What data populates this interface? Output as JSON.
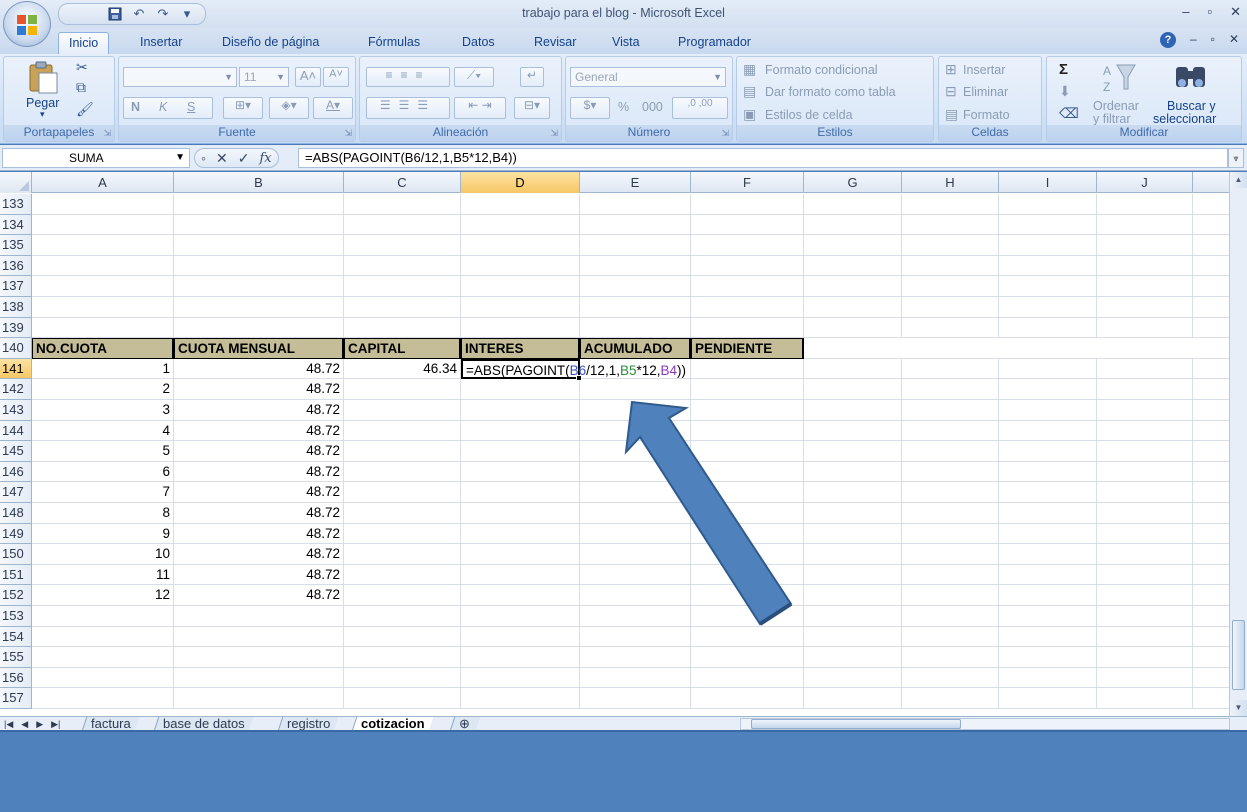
{
  "window": {
    "title": "trabajo para el blog - Microsoft Excel",
    "controls": [
      "–",
      "▫",
      "✕"
    ],
    "doc_controls": [
      "?",
      "–",
      "▫",
      "✕"
    ]
  },
  "ribbon_tabs": [
    "Inicio",
    "Insertar",
    "Diseño de página",
    "Fórmulas",
    "Datos",
    "Revisar",
    "Vista",
    "Programador"
  ],
  "ribbon": {
    "clipboard": {
      "paste": "Pegar",
      "label": "Portapapeles"
    },
    "font": {
      "size": "11",
      "bold": "N",
      "italic": "K",
      "underline": "S",
      "label": "Fuente"
    },
    "alignment": {
      "label": "Alineación"
    },
    "number": {
      "format": "General",
      "percent": "%",
      "thousands": "000",
      "label": "Número"
    },
    "styles": {
      "conditional": "Formato condicional",
      "as_table": "Dar formato como tabla",
      "cell_styles": "Estilos de celda",
      "label": "Estilos"
    },
    "cells": {
      "insert": "Insertar",
      "delete": "Eliminar",
      "format": "Formato",
      "label": "Celdas"
    },
    "editing": {
      "sum": "Σ",
      "sort_1": "Ordenar",
      "sort_2": "y filtrar",
      "find_1": "Buscar y",
      "find_2": "seleccionar",
      "label": "Modificar"
    }
  },
  "formula_bar": {
    "name_box": "SUMA",
    "cancel": "✕",
    "enter": "✓",
    "fx": "fx",
    "formula": "=ABS(PAGOINT(B6/12,1,B5*12,B4))"
  },
  "columns": [
    "A",
    "B",
    "C",
    "D",
    "E",
    "F",
    "G",
    "H",
    "I",
    "J"
  ],
  "selected_column": "D",
  "rows": [
    {
      "n": "133",
      "cells": [
        "",
        "",
        ""
      ]
    },
    {
      "n": "134",
      "cells": [
        "",
        "",
        ""
      ]
    },
    {
      "n": "135",
      "cells": [
        "",
        "",
        ""
      ]
    },
    {
      "n": "136",
      "cells": [
        "",
        "",
        ""
      ]
    },
    {
      "n": "137",
      "cells": [
        "",
        "",
        ""
      ]
    },
    {
      "n": "138",
      "cells": [
        "",
        "",
        ""
      ]
    },
    {
      "n": "139",
      "cells": [
        "",
        "",
        ""
      ]
    },
    {
      "n": "140",
      "cells": [
        "",
        "",
        ""
      ]
    },
    {
      "n": "141",
      "cells": [
        "1",
        "48.72",
        "46.34"
      ]
    },
    {
      "n": "142",
      "cells": [
        "2",
        "48.72",
        ""
      ]
    },
    {
      "n": "143",
      "cells": [
        "3",
        "48.72",
        ""
      ]
    },
    {
      "n": "144",
      "cells": [
        "4",
        "48.72",
        ""
      ]
    },
    {
      "n": "145",
      "cells": [
        "5",
        "48.72",
        ""
      ]
    },
    {
      "n": "146",
      "cells": [
        "6",
        "48.72",
        ""
      ]
    },
    {
      "n": "147",
      "cells": [
        "7",
        "48.72",
        ""
      ]
    },
    {
      "n": "148",
      "cells": [
        "8",
        "48.72",
        ""
      ]
    },
    {
      "n": "149",
      "cells": [
        "9",
        "48.72",
        ""
      ]
    },
    {
      "n": "150",
      "cells": [
        "10",
        "48.72",
        ""
      ]
    },
    {
      "n": "151",
      "cells": [
        "11",
        "48.72",
        ""
      ]
    },
    {
      "n": "152",
      "cells": [
        "12",
        "48.72",
        ""
      ]
    },
    {
      "n": "153",
      "cells": [
        "",
        "",
        ""
      ]
    },
    {
      "n": "154",
      "cells": [
        "",
        "",
        ""
      ]
    },
    {
      "n": "155",
      "cells": [
        "",
        "",
        ""
      ]
    },
    {
      "n": "156",
      "cells": [
        "",
        "",
        ""
      ]
    },
    {
      "n": "157",
      "cells": [
        "",
        "",
        ""
      ]
    }
  ],
  "table_headers": [
    "NO.CUOTA",
    "CUOTA MENSUAL",
    "CAPITAL",
    "INTERES",
    "ACUMULADO",
    "PENDIENTE"
  ],
  "active_cell": {
    "row": "141",
    "parts": [
      "=ABS(PAGOINT(",
      "B6",
      "/12,1,",
      "B5",
      "*12,",
      "B4",
      "))"
    ]
  },
  "sheet_tabs": [
    "factura",
    "base de datos",
    "registro",
    "cotizacion"
  ],
  "active_sheet": "cotizacion",
  "colors": {
    "header_fill": "#c4bd97",
    "annotation_arrow": "#4f81bd",
    "bottom_band": "#4f81bd",
    "ref_b6": "#3a52c4",
    "ref_b5": "#2e8b3a",
    "ref_b4": "#8b3ab8"
  },
  "icons": [
    "office-button-icon",
    "save-icon",
    "undo-icon",
    "redo-icon",
    "paste-icon",
    "cut-icon",
    "copy-icon",
    "format-painter-icon",
    "sum-icon",
    "sort-filter-icon",
    "find-icon",
    "help-icon"
  ]
}
